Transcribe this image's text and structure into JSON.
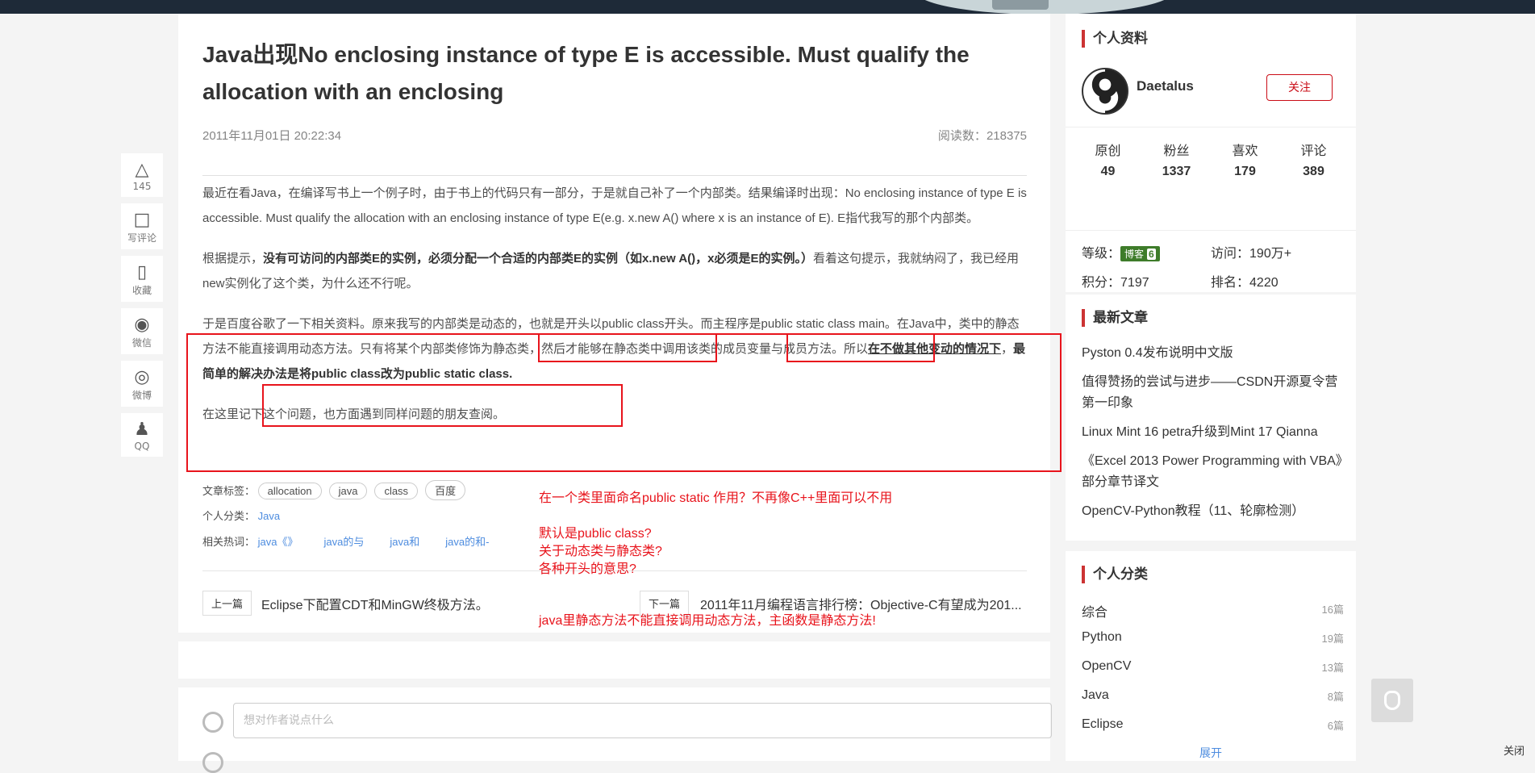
{
  "article": {
    "title": "Java出现No enclosing instance of type E is accessible. Must qualify the allocation with an enclosing",
    "date": "2011年11月01日 20:22:34",
    "reads_label": "阅读数：",
    "reads": "218375",
    "p1": "最近在看Java，在编译写书上一个例子时，由于书上的代码只有一部分，于是就自己补了一个内部类。结果编译时出现：No enclosing instance of type E is accessible. Must qualify the allocation with an enclosing instance of type E(e.g.  x.new A() where x is an instance of E). E指代我写的那个内部类。",
    "p2_a": "根据提示，",
    "p2_b": "没有可访问的内部类E的实例，必须分配一个合适的内部类E的实例（如x.new A()，x必须是E的实例。）",
    "p2_c": "看着这句提示，我就纳闷了，我已经用new实例化了这个类，为什么还不行呢。",
    "p3_a": "于是百度谷歌了一下相关资料。原来我写的内部类是动态的，也就是开头以public class开头。而主程序是public static class main。在Java中，类中的静态方法不能直接调用动态方法。只有将某个内部类修饰为静态类，然后才能够在静态类中调用该类的成员变量与成员方法。所以",
    "p3_b": "在不做其他变动的情况下",
    "p3_c": "，",
    "p3_d": "最简单的解决办法是将public class改为public static class.",
    "p4": "在这里记下这个问题，也方面遇到同样问题的朋友查阅。"
  },
  "tags": {
    "label": "文章标签：",
    "items": [
      "allocation",
      "java",
      "class",
      "百度"
    ],
    "category_label": "个人分类：",
    "category": "Java",
    "hot_label": "相关热词：",
    "hot": [
      "java《》",
      "java的与",
      "java和",
      "java的和-"
    ]
  },
  "pager": {
    "prev_label": "上一篇",
    "prev_title": "Eclipse下配置CDT和MinGW终极方法。",
    "next_label": "下一篇",
    "next_title": "2011年11月编程语言排行榜：Objective-C有望成为201..."
  },
  "comment": {
    "placeholder": "想对作者说点什么"
  },
  "leftbar": [
    {
      "icon": "thumb-up-icon",
      "glyph": "👍",
      "label": "145"
    },
    {
      "icon": "comment-icon",
      "glyph": "💬",
      "label": "写评论"
    },
    {
      "icon": "bookmark-icon",
      "glyph": "🔖",
      "label": "收藏"
    },
    {
      "icon": "wechat-icon",
      "glyph": "◉",
      "label": "微信"
    },
    {
      "icon": "weibo-icon",
      "glyph": "◎",
      "label": "微博"
    },
    {
      "icon": "qq-icon",
      "glyph": "♟",
      "label": "QQ"
    }
  ],
  "profile": {
    "section_title": "个人资料",
    "username": "Daetalus",
    "follow_label": "关注",
    "stats": [
      {
        "label": "原创",
        "value": "49"
      },
      {
        "label": "粉丝",
        "value": "1337"
      },
      {
        "label": "喜欢",
        "value": "179"
      },
      {
        "label": "评论",
        "value": "389"
      }
    ],
    "level_label": "等级：",
    "level_badge": "博客",
    "level_num": "6",
    "visits_label": "访问：",
    "visits": "190万+",
    "points_label": "积分：",
    "points": "7197",
    "rank_label": "排名：",
    "rank": "4220"
  },
  "latest": {
    "section_title": "最新文章",
    "items": [
      "Pyston 0.4发布说明中文版",
      "值得赞扬的尝试与进步——CSDN开源夏令营第一印象",
      "Linux Mint 16 petra升级到Mint 17 Qianna",
      "《Excel 2013 Power Programming with VBA》部分章节译文",
      "OpenCV-Python教程（11、轮廓检测）"
    ]
  },
  "categories": {
    "section_title": "个人分类",
    "items": [
      {
        "name": "综合",
        "count": "16篇"
      },
      {
        "name": "Python",
        "count": "19篇"
      },
      {
        "name": "OpenCV",
        "count": "13篇"
      },
      {
        "name": "Java",
        "count": "8篇"
      },
      {
        "name": "Eclipse",
        "count": "6篇"
      }
    ],
    "expand_label": "展开"
  },
  "notes": {
    "n1": "在一个类里面命名public  static 作用？不再像C++里面可以不用",
    "n2": "默认是public class?",
    "n3": "关于动态类与静态类?",
    "n4": "各种开头的意思?",
    "n5": "java里静态方法不能直接调用动态方法，主函数是静态方法!"
  },
  "close_label": "关闭",
  "colors": {
    "accent_red": "#e8141c",
    "brand_red": "#ca0c16",
    "link_blue": "#4d8cdf",
    "topbar": "#1e2a38"
  }
}
